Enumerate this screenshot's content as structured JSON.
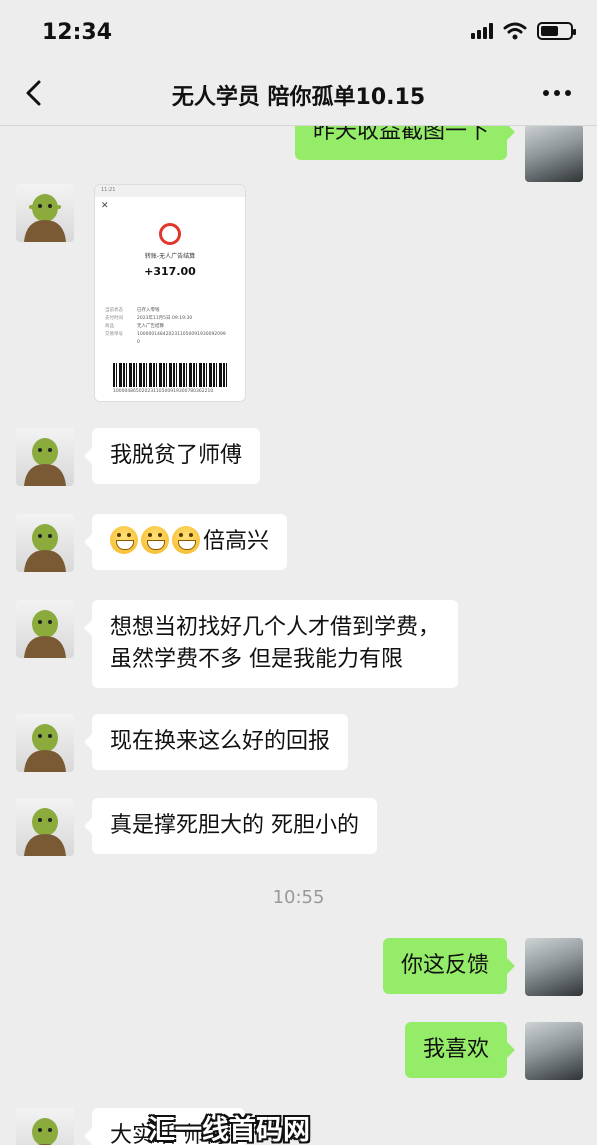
{
  "status_bar": {
    "time": "12:34"
  },
  "nav": {
    "title": "无人学员 陪你孤单10.15"
  },
  "messages": {
    "top_partial_right": "昨天收益截图一下",
    "receipt": {
      "status_top": "11:21",
      "desc": "转账-无人广告结算",
      "amount": "+317.00",
      "rows": [
        {
          "k": "当前状态",
          "v": "已存入零钱"
        },
        {
          "k": "支付时间",
          "v": "2023年11月5日 09:19:30"
        },
        {
          "k": "商品",
          "v": "无人广告结算"
        },
        {
          "k": "交易单号",
          "v": "10000014842023110500919300920990"
        }
      ],
      "barcode_number": "10000486502023110500919300780362210"
    },
    "m1": "我脱贫了师傅",
    "m2_text": "倍高兴",
    "m3_line1": "想想当初找好几个人才借到学费，",
    "m3_line2": "虽然学费不多 但是我能力有限",
    "m4": "现在换来这么好的回报",
    "m5": "真是撑死胆大的 死胆小的",
    "timestamp": "10:55",
    "r1": "你这反馈",
    "r2": "我喜欢",
    "bottom_partial_left": "大实话 师傅"
  },
  "watermark": "汇一线首码网 www.huiyixian.com",
  "colors": {
    "background": "#ededed",
    "bubble_self": "#95ec69",
    "bubble_other": "#ffffff"
  },
  "icons": [
    "back-chevron-icon",
    "more-dots-icon",
    "signal-icon",
    "wifi-icon",
    "battery-icon",
    "grin-emoji-icon"
  ]
}
